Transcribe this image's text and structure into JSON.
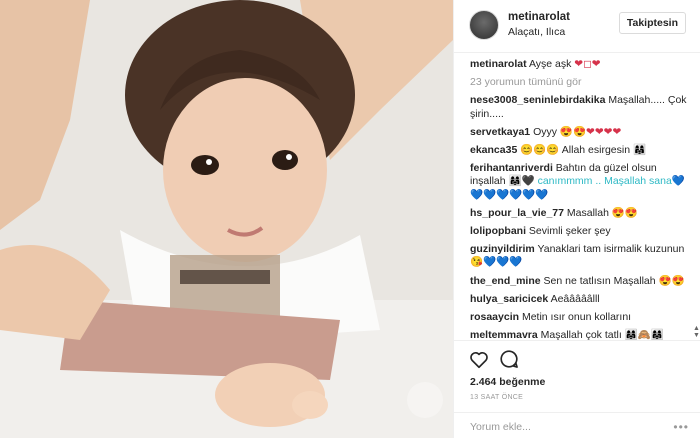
{
  "post": {
    "username": "metinarolat",
    "location": "Alaçatı, Ilıca",
    "follow_label": "Takiptesin"
  },
  "caption": {
    "user": "metinarolat",
    "text": "Ayşe aşk",
    "emoji": "❤◻❤"
  },
  "more_comments": "23 yorumun tümünü gör",
  "comments": [
    {
      "user": "nese3008_seninlebirdakika",
      "text": "Maşallah..... Çok şirin.....",
      "emoji": ""
    },
    {
      "user": "servetkaya1",
      "text": "Oyyy",
      "emoji": "😍😍❤❤❤❤"
    },
    {
      "user": "ekanca35",
      "text": "😊😊😊 Allah esirgesin",
      "emoji": "👩‍👩‍👧"
    },
    {
      "user": "ferihantanriverdi",
      "text": "Bahtın da güzel olsun inşallah",
      "emoji": "👩‍👩‍👧🖤 canımmmm .. Maşallah sana💙💙💙💙💙💙💙"
    },
    {
      "user": "hs_pour_la_vie_77",
      "text": "Masallah",
      "emoji": "😍😍"
    },
    {
      "user": "lolipopbani",
      "text": "Sevimli şeker şey",
      "emoji": ""
    },
    {
      "user": "guzinyildirim",
      "text": "Yanaklari tam isirmalik kuzunun",
      "emoji": "😘💙💙💙"
    },
    {
      "user": "the_end_mine",
      "text": "Sen ne tatlısın Maşallah",
      "emoji": "😍😍"
    },
    {
      "user": "hulya_saricicek",
      "text": "Aeâââââlll",
      "emoji": ""
    },
    {
      "user": "rosaaycin",
      "text": "Metin ısır onun kollarını",
      "emoji": ""
    },
    {
      "user": "meltemmavra",
      "text": "Maşallah çok tatlı",
      "emoji": "👩‍👩‍👧🙈👩‍👩‍👧"
    }
  ],
  "likes": "2.464 beğenme",
  "time": "13 SAAT ÖNCE",
  "comment_input": {
    "placeholder": "Yorum ekle..."
  },
  "more_options": "•••",
  "icons": {
    "like": "heart-outline-icon",
    "comment": "speech-bubble-icon",
    "options": "more-dots-icon"
  },
  "colors": {
    "username": "#262626",
    "muted": "#999999",
    "border": "#efefef",
    "heart": "#d6324a",
    "blue_heart": "#2eb9c5"
  }
}
